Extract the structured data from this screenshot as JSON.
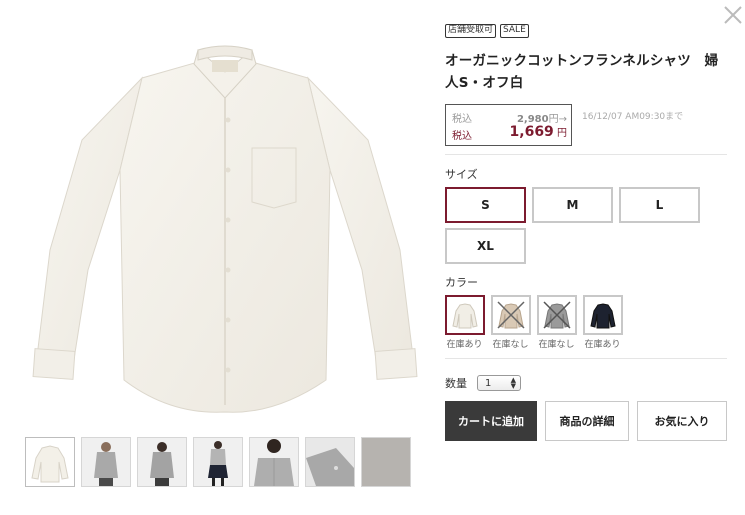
{
  "product": {
    "tags": [
      "店舗受取可",
      "SALE"
    ],
    "title": "オーガニックコットンフランネルシャツ　婦人S・オフ白",
    "price": {
      "tax_label": "税込",
      "original": "2,980",
      "original_unit": "円→",
      "sale": "1,669",
      "sale_unit": "円",
      "deadline": "16/12/07 AM09:30まで"
    }
  },
  "size": {
    "label": "サイズ",
    "options": [
      "S",
      "M",
      "L",
      "XL"
    ],
    "selected": "S"
  },
  "color": {
    "label": "カラー",
    "options": [
      {
        "icon": "off-white-shirt-swatch",
        "stock": "在庫あり",
        "available": true,
        "selected": true
      },
      {
        "icon": "beige-check-shirt-swatch",
        "stock": "在庫なし",
        "available": false,
        "selected": false
      },
      {
        "icon": "gray-check-shirt-swatch",
        "stock": "在庫なし",
        "available": false,
        "selected": false
      },
      {
        "icon": "navy-shirt-swatch",
        "stock": "在庫あり",
        "available": true,
        "selected": false
      }
    ]
  },
  "quantity": {
    "label": "数量",
    "value": "1"
  },
  "actions": {
    "add_to_cart": "カートに追加",
    "details": "商品の詳細",
    "favorite": "お気に入り"
  },
  "thumbnails": [
    "off-white-shirt",
    "gray-shirt-front",
    "gray-shirt-back",
    "model-navy-skirt",
    "model-gray-shirt-closeup",
    "cuff-closeup",
    "fabric-texture"
  ],
  "colors": {
    "accent": "#7c1b2f",
    "button_dark": "#3a3a3a"
  }
}
